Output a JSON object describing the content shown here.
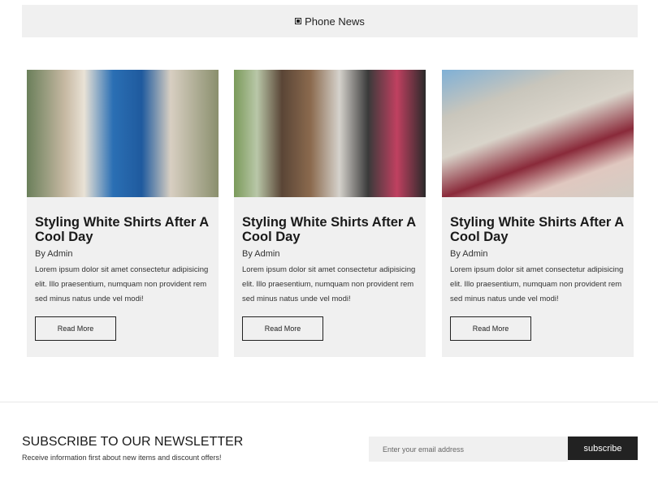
{
  "header": {
    "title": "Phone News",
    "icon": "square-icon"
  },
  "posts": [
    {
      "title": "Styling White Shirts After A Cool Day",
      "author": "By Admin",
      "excerpt": "Lorem ipsum dolor sit amet consectetur adipisicing elit. Illo praesentium, numquam non provident rem sed minus natus unde vel modi!",
      "button": "Read More"
    },
    {
      "title": "Styling White Shirts After A Cool Day",
      "author": "By Admin",
      "excerpt": "Lorem ipsum dolor sit amet consectetur adipisicing elit. Illo praesentium, numquam non provident rem sed minus natus unde vel modi!",
      "button": "Read More"
    },
    {
      "title": "Styling White Shirts After A Cool Day",
      "author": "By Admin",
      "excerpt": "Lorem ipsum dolor sit amet consectetur adipisicing elit. Illo praesentium, numquam non provident rem sed minus natus unde vel modi!",
      "button": "Read More"
    }
  ],
  "newsletter": {
    "title": "SUBSCRIBE TO OUR NEWSLETTER",
    "subtitle": "Receive information first about new items and discount offers!",
    "placeholder": "Enter your email address",
    "button": "subscribe"
  }
}
